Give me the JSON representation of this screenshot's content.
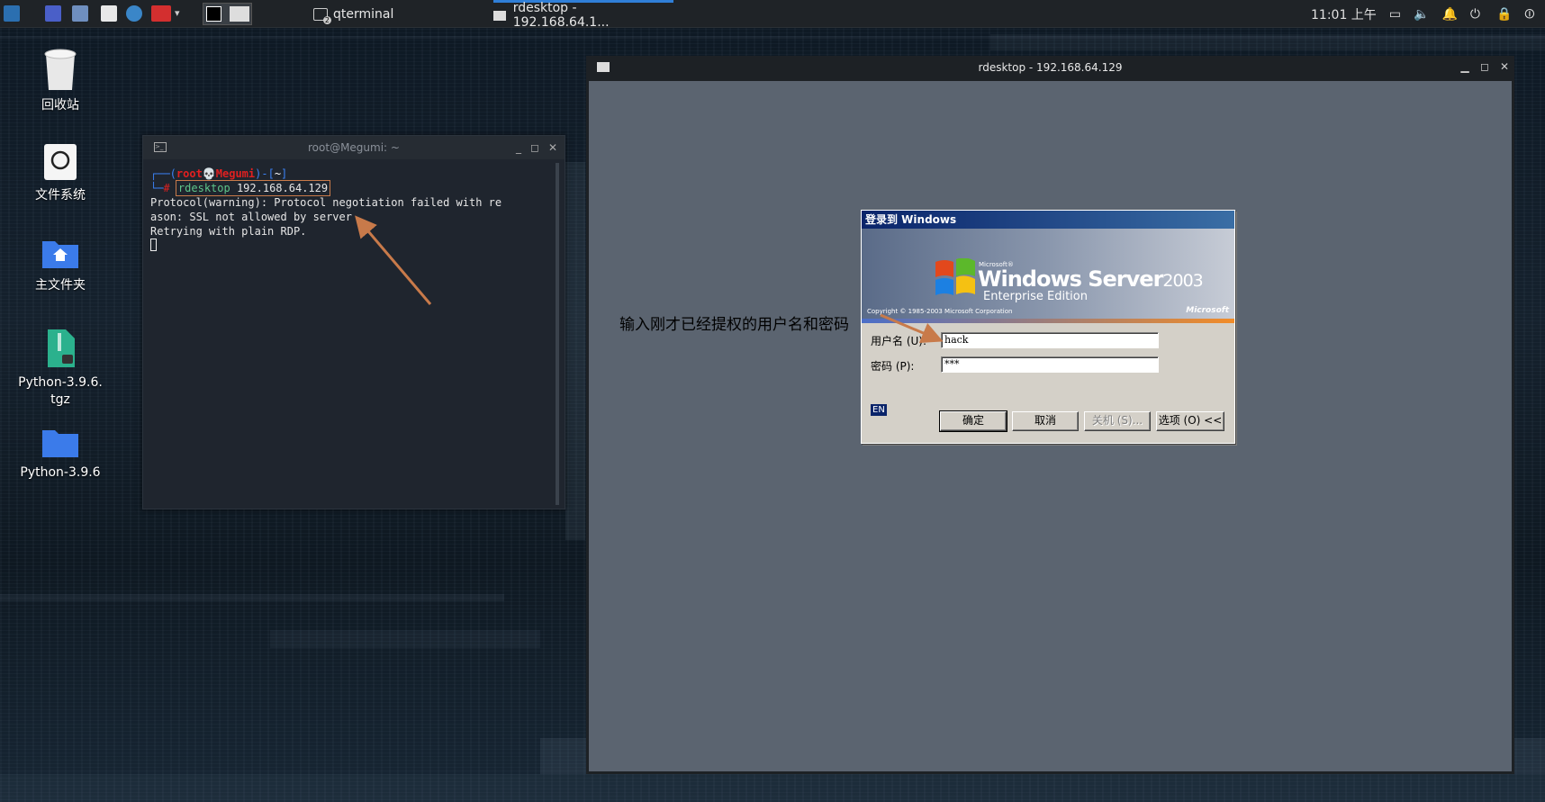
{
  "panel": {
    "tasks": [
      {
        "label": "qterminal",
        "badge": "2"
      },
      {
        "label": "rdesktop - 192.168.64.1..."
      }
    ],
    "clock": "11:01 上午"
  },
  "desktop": {
    "icons": [
      {
        "label": "回收站"
      },
      {
        "label": "文件系统"
      },
      {
        "label": "主文件夹"
      },
      {
        "label": "Python-3.9.6.\ntgz"
      },
      {
        "label": "Python-3.9.6"
      }
    ]
  },
  "terminal": {
    "title": "root@Megumi: ~",
    "prompt_user": "root",
    "prompt_host": "Megumi",
    "prompt_dir": "~",
    "command": "rdesktop 192.168.64.129",
    "output": [
      "Protocol(warning): Protocol negotiation failed with re",
      "ason: SSL not allowed by server",
      "Retrying with plain RDP."
    ]
  },
  "rdp": {
    "title": "rdesktop - 192.168.64.129"
  },
  "dialog": {
    "caption": "登录到 Windows",
    "brand_small": "Microsoft®",
    "brand_windows": "Windows Server",
    "brand_year": "2003",
    "brand_edition": "Enterprise Edition",
    "copyright": "Copyright © 1985-2003  Microsoft Corporation",
    "microsoft": "Microsoft",
    "username_label": "用户名 (U):",
    "username_value": "hack",
    "password_label": "密码 (P):",
    "password_value": "***",
    "lang": "EN",
    "ok": "确定",
    "cancel": "取消",
    "shutdown": "关机 (S)...",
    "options": "选项 (O) <<"
  },
  "annotation": "输入刚才已经提权的用户名和密码",
  "colors": {
    "accent_arrow": "#c87a4a",
    "prompt_red": "#e02020",
    "prompt_blue": "#3b82f6"
  }
}
